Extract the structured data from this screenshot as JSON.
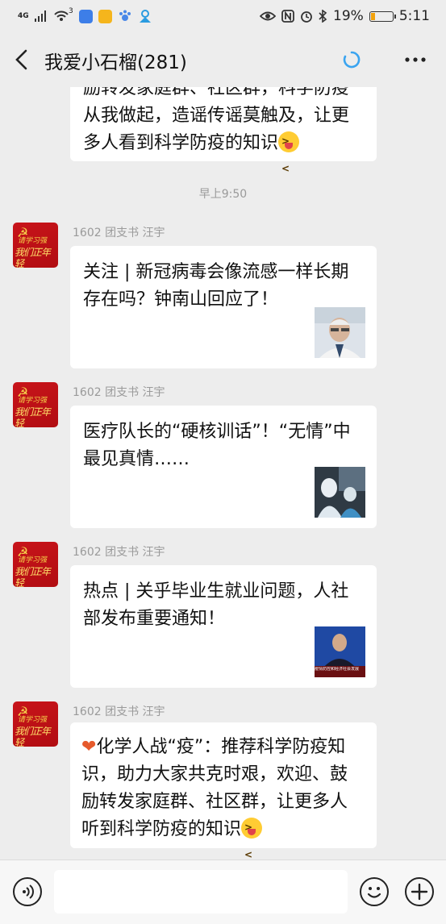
{
  "status_bar": {
    "network": "4G",
    "signal_superscript": "3",
    "battery_text": "19%",
    "battery_level": 0.19,
    "time": "5:11"
  },
  "header": {
    "title": "我爱小石榴(281)",
    "icons": [
      "back-arrow-icon",
      "loading-spinner-icon",
      "more-icon"
    ]
  },
  "chat": {
    "prev_message": {
      "lines": [
        "励转发家庭群、社区群，科学防疫",
        "从我做起，造谣传谣莫触及，让更",
        "多人看到科学防疫的知识"
      ]
    },
    "timestamp": "早上9:50",
    "messages": [
      {
        "sender": "1602 团支书 汪宇",
        "lines": [
          "关注 | 新冠病毒会像流感一样长期",
          "存在吗？钟南山回应了！"
        ],
        "thumb": "photo-thumbnail-icon"
      },
      {
        "sender": "1602 团支书 汪宇",
        "lines": [
          "医疗队长的“硬核训话”！“无情”中",
          "最见真情……"
        ],
        "thumb": "photo-thumbnail-icon"
      },
      {
        "sender": "1602 团支书 汪宇",
        "lines": [
          "热点 | 关乎毕业生就业问题，人社",
          "部发布重要通知！"
        ],
        "thumb": "photo-thumbnail-icon",
        "thumb_caption": "疫情防控和经济社会发展"
      },
      {
        "sender": "1602 团支书 汪宇",
        "lines": [
          "化学人战“疫”：推荐科学防疫知",
          "识，助力大家共克时艰，欢迎、鼓",
          "励转发家庭群、社区群，让更多人",
          "听到科学防疫的知识"
        ]
      }
    ],
    "avatar_lines": [
      "请学习强",
      "我们正年轻"
    ]
  },
  "bottom_bar": {
    "icons": [
      "voice-icon",
      "emoji-icon",
      "plus-icon"
    ]
  },
  "colors": {
    "accent": "#3aa4f0",
    "avatar_red": "#c8141a"
  }
}
